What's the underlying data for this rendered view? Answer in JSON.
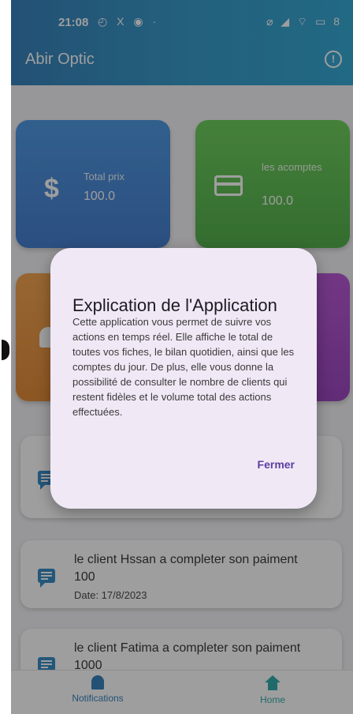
{
  "status_bar": {
    "time": "21:08",
    "left_icons": "◴ X ◉ ·",
    "right_icons": "⌀ ◢ ⌔ ▭ 8"
  },
  "app_bar": {
    "title": "Abir Optic",
    "info_icon": "info-circle-icon"
  },
  "cards": [
    {
      "label": "Total prix",
      "value": "100.0",
      "icon": "dollar-icon",
      "color": "#3a82d9"
    },
    {
      "label": "les acomptes",
      "value": "100.0",
      "icon": "credit-card-icon",
      "color": "#4fb940"
    },
    {
      "label": "",
      "value": "",
      "icon": "bell-icon",
      "color": "#ea8a2c"
    },
    {
      "label": "",
      "value": "",
      "icon": "",
      "color": "#a23ac6"
    }
  ],
  "notifications": [
    {
      "text": "",
      "amount": "",
      "date": ""
    },
    {
      "text": "le client Hssan a completer son paiment",
      "amount": "100",
      "date": "Date: 17/8/2023"
    },
    {
      "text": "le client Fatima a completer son paiment",
      "amount": "1000",
      "date": ""
    }
  ],
  "dialog": {
    "title": "Explication de l'Application",
    "body": "Cette application vous permet de suivre vos actions en temps réel. Elle affiche le total de toutes vos fiches, le bilan quotidien, ainsi que les comptes du jour. De plus, elle vous donne la possibilité de consulter le nombre de clients qui restent fidèles et le volume total des actions effectuées.",
    "button": "Fermer"
  },
  "bottom_nav": [
    {
      "label": "Notifications",
      "icon": "bell-icon"
    },
    {
      "label": "Home",
      "icon": "home-icon"
    }
  ],
  "colors": {
    "app_bar": "#1f86c0",
    "dialog_bg": "#f1e8f6",
    "button_text": "#5b3fa0"
  }
}
